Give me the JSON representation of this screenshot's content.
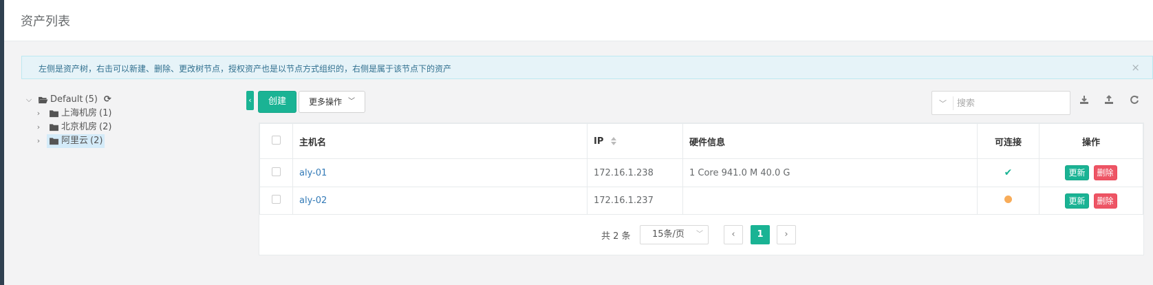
{
  "page": {
    "title": "资产列表"
  },
  "alert": {
    "text": "左侧是资产树，右击可以新建、删除、更改树节点，授权资产也是以节点方式组织的，右侧是属于该节点下的资产",
    "close_label": "×"
  },
  "tree": {
    "root": {
      "label": "Default",
      "count": "(5)"
    },
    "children": [
      {
        "label": "上海机房",
        "count": "(1)"
      },
      {
        "label": "北京机房",
        "count": "(2)"
      },
      {
        "label": "阿里云",
        "count": "(2)",
        "selected": true
      }
    ]
  },
  "toolbar": {
    "collapse_label": "‹",
    "create_label": "创建",
    "more_label": "更多操作",
    "search_placeholder": "搜索"
  },
  "table": {
    "columns": [
      "主机名",
      "IP",
      "硬件信息",
      "可连接",
      "操作"
    ],
    "rows": [
      {
        "hostname": "aly-01",
        "ip": "172.16.1.238",
        "hardware": "1 Core 941.0 M 40.0 G",
        "connectable": "ok"
      },
      {
        "hostname": "aly-02",
        "ip": "172.16.1.237",
        "hardware": "",
        "connectable": "unknown"
      }
    ],
    "update_label": "更新",
    "delete_label": "删除"
  },
  "pagination": {
    "total_text": "共 2 条",
    "page_size": "15条/页",
    "current_page": "1",
    "prev_label": "‹",
    "next_label": "›"
  },
  "colors": {
    "primary": "#1ab394",
    "danger": "#ed5565",
    "warning": "#f8ac59",
    "link": "#337ab7"
  }
}
